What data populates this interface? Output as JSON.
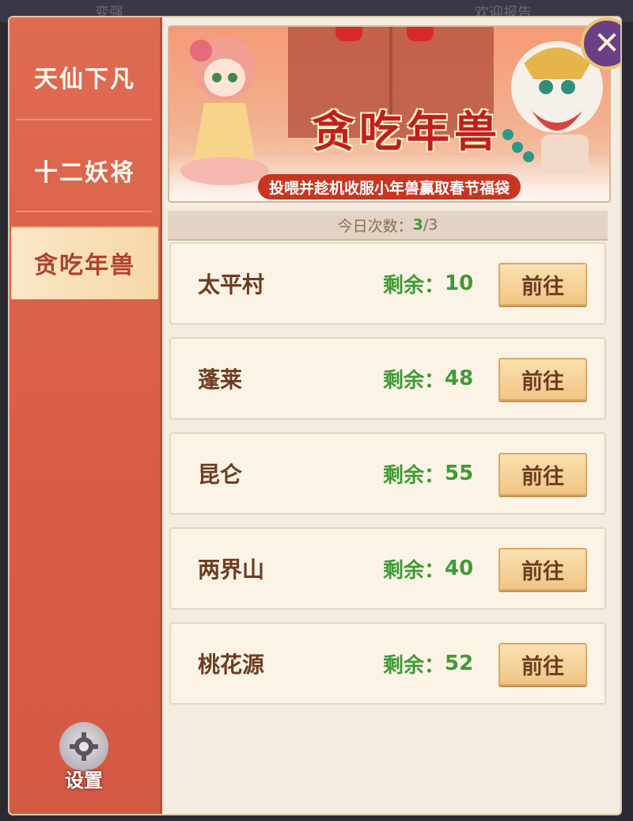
{
  "background": {
    "ghost_left": "变强",
    "ghost_right": "欢迎报告"
  },
  "sidebar": {
    "items": [
      {
        "label": "天仙下凡"
      },
      {
        "label": "十二妖将"
      },
      {
        "label": "贪吃年兽"
      }
    ],
    "active_index": 2,
    "settings_label": "设置"
  },
  "banner": {
    "title": "贪吃年兽",
    "subtitle": "投喂并趁机收服小年兽赢取春节福袋"
  },
  "count": {
    "label": "今日次数：",
    "current": "3",
    "total": "/3"
  },
  "remain_label": "剩余：",
  "go_label": "前往",
  "destinations": [
    {
      "name": "太平村",
      "remaining": "10"
    },
    {
      "name": "蓬莱",
      "remaining": "48"
    },
    {
      "name": "昆仑",
      "remaining": "55"
    },
    {
      "name": "两界山",
      "remaining": "40"
    },
    {
      "name": "桃花源",
      "remaining": "52"
    }
  ],
  "colors": {
    "sidebar_bg": "#df6b52",
    "active_tab": "#fbe7c8",
    "remain_green": "#3f9a35",
    "close_button": "#6b3f86"
  }
}
